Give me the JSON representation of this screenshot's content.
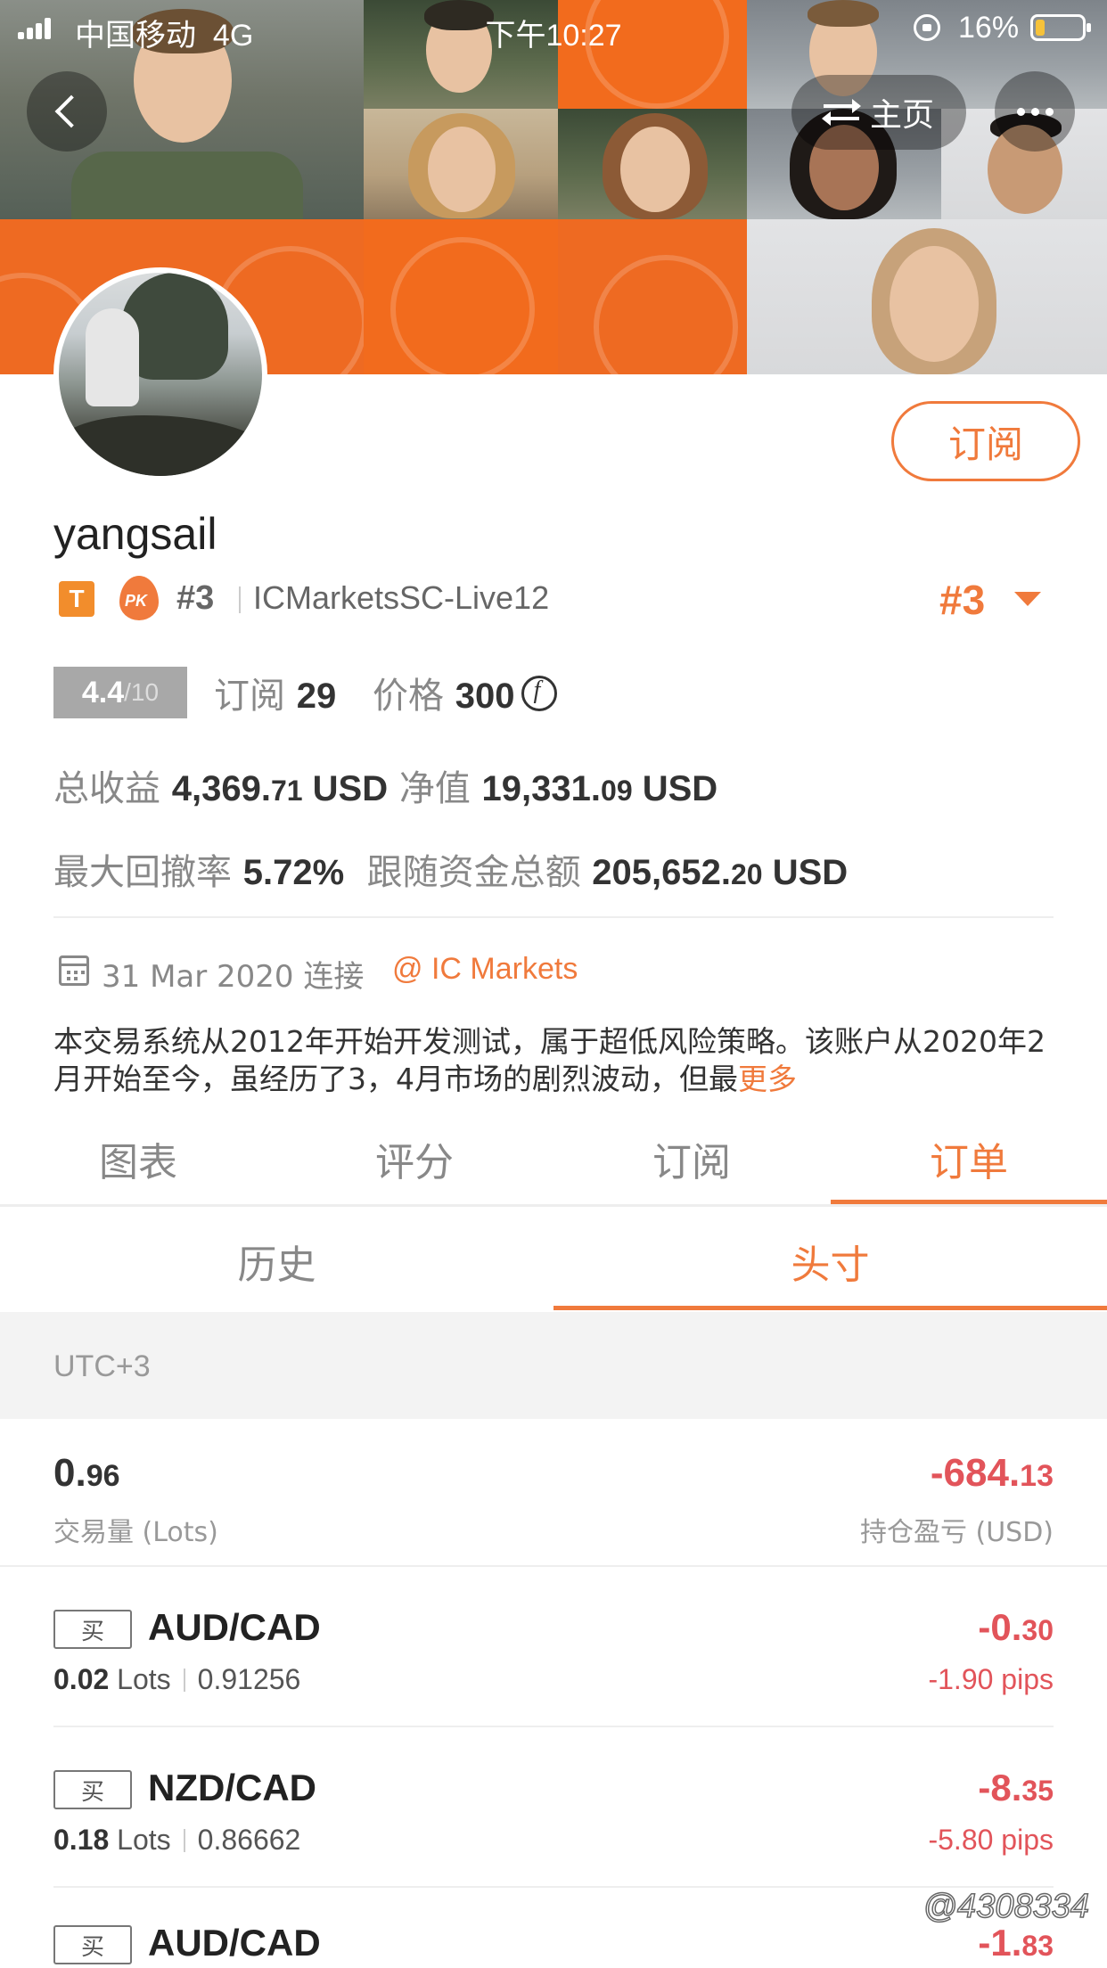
{
  "status_bar": {
    "carrier": "中国移动",
    "network": "4G",
    "time": "下午10:27",
    "battery": "16%",
    "battery_level": 0.16
  },
  "header": {
    "home_label": "主页"
  },
  "profile": {
    "username": "yangsail",
    "badge_letter": "T",
    "pk_label": "PK",
    "rank": "#3",
    "server": "ICMarketsSC-Live12",
    "rank_selector": "#3",
    "subscribe_label": "订阅"
  },
  "stats": {
    "score": "4.4",
    "score_denominator": "/10",
    "subscribe_label": "订阅",
    "subscribe_count": "29",
    "price_label": "价格",
    "price_value": "300",
    "total_profit_label": "总收益",
    "total_profit_int": "4,369.",
    "total_profit_dec": "71",
    "total_profit_unit": "USD",
    "equity_label": "净值",
    "equity_int": "19,331.",
    "equity_dec": "09",
    "equity_unit": "USD",
    "max_drawdown_label": "最大回撤率",
    "max_drawdown_value": "5.72%",
    "follow_funds_label": "跟随资金总额",
    "follow_funds_int": "205,652.",
    "follow_funds_dec": "20",
    "follow_funds_unit": "USD"
  },
  "info": {
    "connect_date": "31 Mar 2020 连接",
    "broker": "@ IC Markets",
    "description": "本交易系统从2012年开始开发测试，属于超低风险策略。该账户从2020年2月开始至今，虽经历了3，4月市场的剧烈波动，但最",
    "more_label": "更多"
  },
  "tabs": [
    "图表",
    "评分",
    "订阅",
    "订单"
  ],
  "active_tab": 3,
  "subtabs": [
    "历史",
    "头寸"
  ],
  "active_subtab": 1,
  "timezone": "UTC+3",
  "summary": {
    "lots_int": "0.",
    "lots_dec": "96",
    "lots_label": "交易量 (Lots)",
    "pl_int": "-684.",
    "pl_dec": "13",
    "pl_label": "持仓盈亏 (USD)"
  },
  "orders": [
    {
      "side": "买",
      "pair": "AUD/CAD",
      "lots": "0.02",
      "lots_unit": "Lots",
      "price": "0.91256",
      "pl_int": "-0.",
      "pl_dec": "30",
      "pips": "-1.90 pips"
    },
    {
      "side": "买",
      "pair": "NZD/CAD",
      "lots": "0.18",
      "lots_unit": "Lots",
      "price": "0.86662",
      "pl_int": "-8.",
      "pl_dec": "35",
      "pips": "-5.80 pips"
    },
    {
      "side": "买",
      "pair": "AUD/CAD",
      "lots": "",
      "lots_unit": "",
      "price": "",
      "pl_int": "-1.",
      "pl_dec": "83",
      "pips": ""
    }
  ],
  "watermark": "@4308334",
  "colors": {
    "accent": "#f07a3c",
    "banner": "#f26b1d",
    "loss": "#e2545a"
  }
}
